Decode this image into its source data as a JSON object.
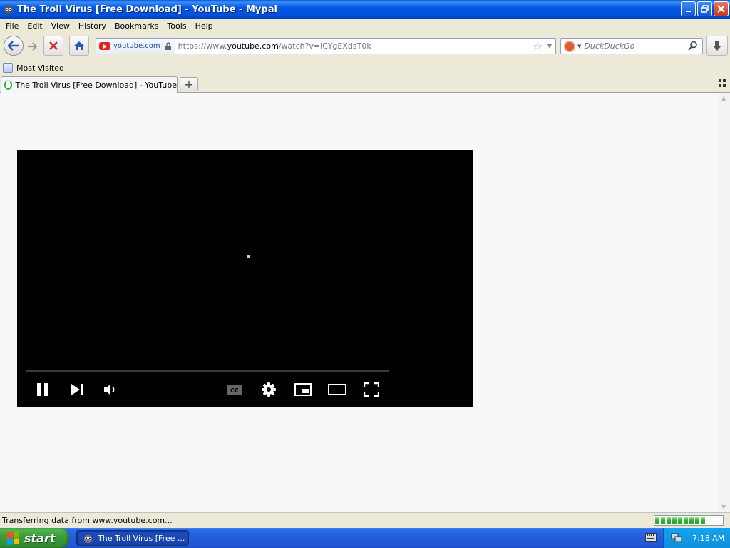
{
  "window": {
    "title": "The Troll Virus [Free Download] - YouTube - Mypal",
    "controls": {
      "minimize": "_",
      "maximize": "❐",
      "close": "✕"
    }
  },
  "menubar": {
    "items": [
      "File",
      "Edit",
      "View",
      "History",
      "Bookmarks",
      "Tools",
      "Help"
    ]
  },
  "navbar": {
    "identity_domain": "youtube.com",
    "url_prefix": "https://www.",
    "url_host": "youtube.com",
    "url_path": "/watch?v=lCYgEXdsT0k",
    "star_icon": "☆",
    "dropmarker": "▼"
  },
  "search": {
    "engine_icon": "duckduckgo-icon",
    "placeholder": "DuckDuckGo",
    "drop": "▼"
  },
  "bookmarks": {
    "items": [
      "Most Visited"
    ]
  },
  "tabs": [
    {
      "label": "The Troll Virus [Free Download] - YouTube",
      "loading": true
    }
  ],
  "newtab_label": "+",
  "player": {
    "state": "playing",
    "progress": 0
  },
  "status": {
    "text": "Transferring data from www.youtube.com...",
    "progress_segments": 9
  },
  "taskbar": {
    "start_label": "start",
    "task_label": "The Troll Virus [Free ...",
    "clock": "7:18 AM"
  },
  "colors": {
    "titlebar": "#0058e6",
    "taskbar": "#245edb",
    "start": "#3c9d3b",
    "player_bg": "#000000"
  }
}
